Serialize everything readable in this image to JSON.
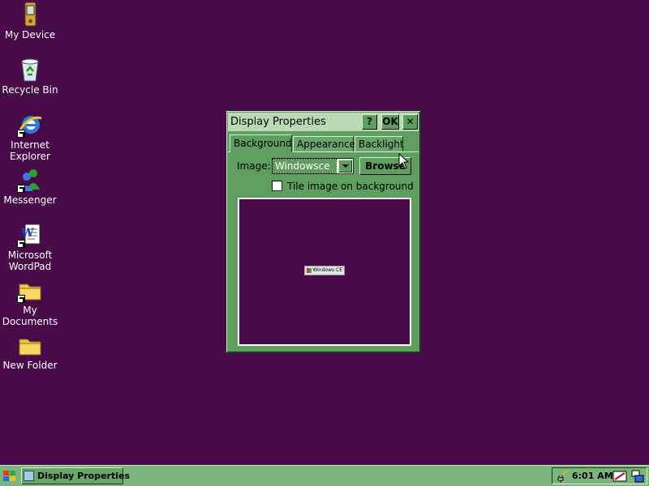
{
  "desktop": {
    "icons": [
      {
        "label_lines": [
          "My Device"
        ]
      },
      {
        "label_lines": [
          "Recycle Bin"
        ]
      },
      {
        "label_lines": [
          "Internet",
          "Explorer"
        ]
      },
      {
        "label_lines": [
          "Messenger"
        ]
      },
      {
        "label_lines": [
          "Microsoft",
          "WordPad"
        ]
      },
      {
        "label_lines": [
          "My",
          "Documents"
        ]
      },
      {
        "label_lines": [
          "New Folder"
        ]
      }
    ]
  },
  "dialog": {
    "title": "Display Properties",
    "help_label": "?",
    "ok_label": "OK",
    "close_label": "✕",
    "tabs": [
      {
        "label": "Background",
        "active": true
      },
      {
        "label": "Appearance",
        "active": false
      },
      {
        "label": "Backlight",
        "active": false
      }
    ],
    "image_label": "Image:",
    "image_value": "Windowsce",
    "browse_label": "Browse",
    "tile_label": "Tile image on background",
    "tile_checked": false,
    "preview_logo": "Windows CE"
  },
  "taskbar": {
    "task_label": "Display Properties",
    "clock": "6:01 AM"
  },
  "colors": {
    "desktop": "#480a48",
    "window": "#5e9e5e",
    "titlebar": "#bcd9b6",
    "taskbar": "#7cb57c"
  }
}
